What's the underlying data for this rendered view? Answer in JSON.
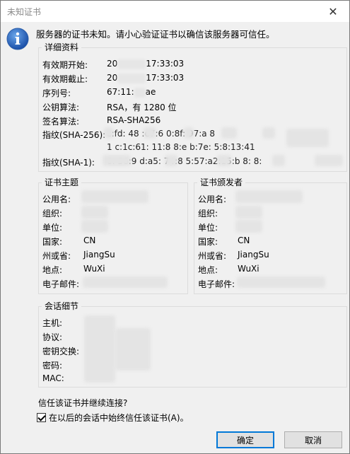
{
  "window": {
    "title": "未知证书",
    "close_glyph": "✕"
  },
  "message": "服务器的证书未知。请小心验证证书以确信该服务器可信任。",
  "details": {
    "legend": "详细资料",
    "valid_from_label": "有效期开始:",
    "valid_from_prefix": "20",
    "valid_from_suffix": "17:33:03",
    "valid_to_label": "有效期截止:",
    "valid_to_prefix": "20",
    "valid_to_suffix": "17:33:03",
    "serial_label": "序列号:",
    "serial_prefix": "67:11:",
    "serial_suffix": "ae",
    "pubkey_label": "公钥算法:",
    "pubkey_value": "RSA，有 1280 位",
    "sigalg_label": "签名算法:",
    "sigalg_value": "RSA-SHA256",
    "sha256_label": "指纹(SHA-256):",
    "sha256_line1": "c:fd:  48  :e7:6   0:8f:   97:a   8   ",
    "sha256_line2": "1   c:1c:61:   11:8   8:e   b:7e:   5:8:13:41",
    "sha1_label": "指纹(SHA-1):",
    "sha1_value": "6:   56:9   d:a5:   74:8   5:57:a2:15:b   8:   8:"
  },
  "subject": {
    "legend": "证书主题",
    "cn_label": "公用名:",
    "org_label": "组织:",
    "unit_label": "单位:",
    "country_label": "国家:",
    "country_value": "CN",
    "state_label": "州或省:",
    "state_value": "JiangSu",
    "locality_label": "地点:",
    "locality_value": "WuXi",
    "email_label": "电子邮件:"
  },
  "issuer": {
    "legend": "证书颁发者",
    "cn_label": "公用名:",
    "org_label": "组织:",
    "unit_label": "单位:",
    "country_label": "国家:",
    "country_value": "CN",
    "state_label": "州或省:",
    "state_value": "JiangSu",
    "locality_label": "地点:",
    "locality_value": "WuXi",
    "email_label": "电子邮件:"
  },
  "session": {
    "legend": "会话细节",
    "host_label": "主机:",
    "protocol_label": "协议:",
    "kex_label": "密钥交换:",
    "cipher_label": "密码:",
    "mac_label": "MAC:"
  },
  "question": "信任该证书并继续连接?",
  "always_trust": {
    "label": "在以后的会话中始终信任该证书(A)。",
    "checked": true
  },
  "buttons": {
    "ok": "确定",
    "cancel": "取消"
  },
  "colors": {
    "accent": "#0078d7",
    "info_icon_blue": "#1a5fb4"
  }
}
